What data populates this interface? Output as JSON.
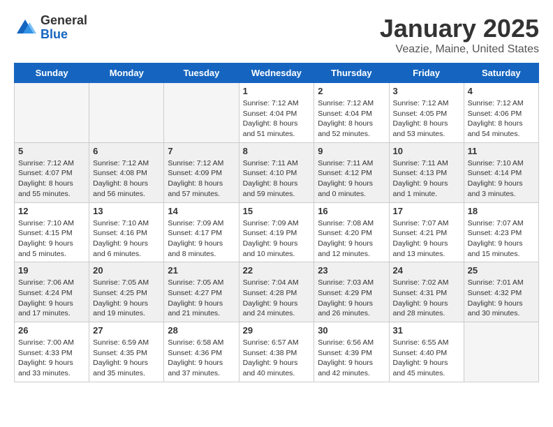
{
  "logo": {
    "general": "General",
    "blue": "Blue"
  },
  "title": "January 2025",
  "location": "Veazie, Maine, United States",
  "days_of_week": [
    "Sunday",
    "Monday",
    "Tuesday",
    "Wednesday",
    "Thursday",
    "Friday",
    "Saturday"
  ],
  "weeks": [
    [
      {
        "day": "",
        "info": ""
      },
      {
        "day": "",
        "info": ""
      },
      {
        "day": "",
        "info": ""
      },
      {
        "day": "1",
        "info": "Sunrise: 7:12 AM\nSunset: 4:04 PM\nDaylight: 8 hours and 51 minutes."
      },
      {
        "day": "2",
        "info": "Sunrise: 7:12 AM\nSunset: 4:04 PM\nDaylight: 8 hours and 52 minutes."
      },
      {
        "day": "3",
        "info": "Sunrise: 7:12 AM\nSunset: 4:05 PM\nDaylight: 8 hours and 53 minutes."
      },
      {
        "day": "4",
        "info": "Sunrise: 7:12 AM\nSunset: 4:06 PM\nDaylight: 8 hours and 54 minutes."
      }
    ],
    [
      {
        "day": "5",
        "info": "Sunrise: 7:12 AM\nSunset: 4:07 PM\nDaylight: 8 hours and 55 minutes."
      },
      {
        "day": "6",
        "info": "Sunrise: 7:12 AM\nSunset: 4:08 PM\nDaylight: 8 hours and 56 minutes."
      },
      {
        "day": "7",
        "info": "Sunrise: 7:12 AM\nSunset: 4:09 PM\nDaylight: 8 hours and 57 minutes."
      },
      {
        "day": "8",
        "info": "Sunrise: 7:11 AM\nSunset: 4:10 PM\nDaylight: 8 hours and 59 minutes."
      },
      {
        "day": "9",
        "info": "Sunrise: 7:11 AM\nSunset: 4:12 PM\nDaylight: 9 hours and 0 minutes."
      },
      {
        "day": "10",
        "info": "Sunrise: 7:11 AM\nSunset: 4:13 PM\nDaylight: 9 hours and 1 minute."
      },
      {
        "day": "11",
        "info": "Sunrise: 7:10 AM\nSunset: 4:14 PM\nDaylight: 9 hours and 3 minutes."
      }
    ],
    [
      {
        "day": "12",
        "info": "Sunrise: 7:10 AM\nSunset: 4:15 PM\nDaylight: 9 hours and 5 minutes."
      },
      {
        "day": "13",
        "info": "Sunrise: 7:10 AM\nSunset: 4:16 PM\nDaylight: 9 hours and 6 minutes."
      },
      {
        "day": "14",
        "info": "Sunrise: 7:09 AM\nSunset: 4:17 PM\nDaylight: 9 hours and 8 minutes."
      },
      {
        "day": "15",
        "info": "Sunrise: 7:09 AM\nSunset: 4:19 PM\nDaylight: 9 hours and 10 minutes."
      },
      {
        "day": "16",
        "info": "Sunrise: 7:08 AM\nSunset: 4:20 PM\nDaylight: 9 hours and 12 minutes."
      },
      {
        "day": "17",
        "info": "Sunrise: 7:07 AM\nSunset: 4:21 PM\nDaylight: 9 hours and 13 minutes."
      },
      {
        "day": "18",
        "info": "Sunrise: 7:07 AM\nSunset: 4:23 PM\nDaylight: 9 hours and 15 minutes."
      }
    ],
    [
      {
        "day": "19",
        "info": "Sunrise: 7:06 AM\nSunset: 4:24 PM\nDaylight: 9 hours and 17 minutes."
      },
      {
        "day": "20",
        "info": "Sunrise: 7:05 AM\nSunset: 4:25 PM\nDaylight: 9 hours and 19 minutes."
      },
      {
        "day": "21",
        "info": "Sunrise: 7:05 AM\nSunset: 4:27 PM\nDaylight: 9 hours and 21 minutes."
      },
      {
        "day": "22",
        "info": "Sunrise: 7:04 AM\nSunset: 4:28 PM\nDaylight: 9 hours and 24 minutes."
      },
      {
        "day": "23",
        "info": "Sunrise: 7:03 AM\nSunset: 4:29 PM\nDaylight: 9 hours and 26 minutes."
      },
      {
        "day": "24",
        "info": "Sunrise: 7:02 AM\nSunset: 4:31 PM\nDaylight: 9 hours and 28 minutes."
      },
      {
        "day": "25",
        "info": "Sunrise: 7:01 AM\nSunset: 4:32 PM\nDaylight: 9 hours and 30 minutes."
      }
    ],
    [
      {
        "day": "26",
        "info": "Sunrise: 7:00 AM\nSunset: 4:33 PM\nDaylight: 9 hours and 33 minutes."
      },
      {
        "day": "27",
        "info": "Sunrise: 6:59 AM\nSunset: 4:35 PM\nDaylight: 9 hours and 35 minutes."
      },
      {
        "day": "28",
        "info": "Sunrise: 6:58 AM\nSunset: 4:36 PM\nDaylight: 9 hours and 37 minutes."
      },
      {
        "day": "29",
        "info": "Sunrise: 6:57 AM\nSunset: 4:38 PM\nDaylight: 9 hours and 40 minutes."
      },
      {
        "day": "30",
        "info": "Sunrise: 6:56 AM\nSunset: 4:39 PM\nDaylight: 9 hours and 42 minutes."
      },
      {
        "day": "31",
        "info": "Sunrise: 6:55 AM\nSunset: 4:40 PM\nDaylight: 9 hours and 45 minutes."
      },
      {
        "day": "",
        "info": ""
      }
    ]
  ],
  "empty_weeks": [
    0,
    1,
    2,
    3,
    4
  ],
  "empty_cols_week0": [
    0,
    1,
    2
  ]
}
